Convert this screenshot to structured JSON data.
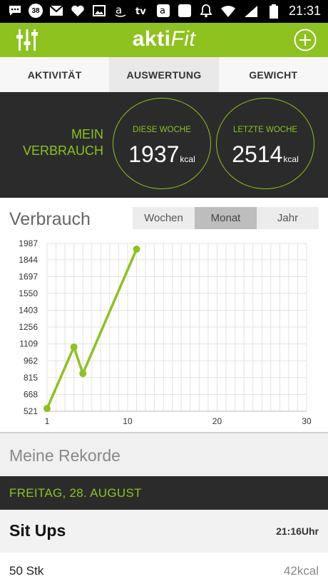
{
  "status_bar": {
    "notification_badge": "38",
    "time": "21:31",
    "left_icons": [
      "chat-icon",
      "badge-38",
      "gmail-icon",
      "heart-icon",
      "image-icon",
      "amazon-icon",
      "tv-icon",
      "amazon-icon",
      "square-icon",
      "bell-icon"
    ],
    "right_icons": [
      "wifi-icon",
      "signal-icon",
      "battery-icon"
    ]
  },
  "app_bar": {
    "logo_main": "akti",
    "logo_accent": "Fit",
    "accent_color": "#8dc21f"
  },
  "tabs": [
    {
      "label": "AKTIVITÄT",
      "active": false
    },
    {
      "label": "AUSWERTUNG",
      "active": true
    },
    {
      "label": "GEWICHT",
      "active": false
    }
  ],
  "summary": {
    "label_line1": "MEIN",
    "label_line2": "VERBRAUCH",
    "this_week": {
      "title": "DIESE WOCHE",
      "value": "1937",
      "unit": "kcal"
    },
    "last_week": {
      "title": "LETZTE WOCHE",
      "value": "2514",
      "unit": "kcal"
    }
  },
  "chart_section": {
    "title": "Verbrauch",
    "periods": [
      {
        "label": "Wochen",
        "active": false
      },
      {
        "label": "Monat",
        "active": true
      },
      {
        "label": "Jahr",
        "active": false
      }
    ]
  },
  "chart_data": {
    "type": "line",
    "title": "Verbrauch",
    "x": [
      1,
      4,
      5,
      11
    ],
    "values": [
      545,
      1082,
      850,
      1937
    ],
    "xlim": [
      1,
      30
    ],
    "ylim": [
      521,
      1987
    ],
    "x_ticks": [
      "1",
      "10",
      "20",
      "30"
    ],
    "y_ticks": [
      "521",
      "668",
      "815",
      "962",
      "1109",
      "1256",
      "1403",
      "1550",
      "1697",
      "1844",
      "1987"
    ],
    "grid": true,
    "color": "#8dc21f"
  },
  "records": {
    "title": "Meine Rekorde",
    "date": "FREITAG, 28. AUGUST",
    "exercise": "Sit Ups",
    "time": "21:16Uhr",
    "count": "50 Stk",
    "kcal": "42kcal"
  }
}
